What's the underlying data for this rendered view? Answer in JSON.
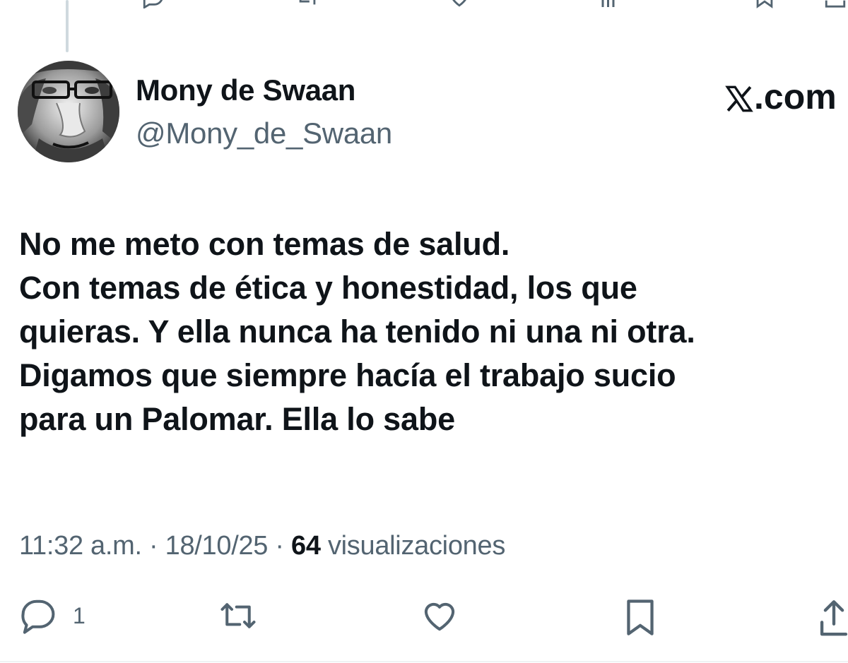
{
  "tweet": {
    "display_name": "Mony de Swaan",
    "handle": "@Mony_de_Swaan",
    "brand": ".com",
    "text_lines": [
      "No me meto con temas de salud.",
      "Con temas de ética y honestidad, los que",
      "quieras. Y ella nunca ha tenido ni una ni otra.",
      "Digamos que siempre hacía el trabajo sucio",
      "para un Palomar. Ella lo sabe"
    ],
    "time": "11:32 a.m.",
    "date": "18/10/25",
    "separator": " · ",
    "views_count": "64",
    "views_label": "visualizaciones",
    "reply_count": "1"
  },
  "icons": {
    "reply": "speech-bubble-icon",
    "retweet": "retweet-icon",
    "like": "heart-icon",
    "bookmark": "bookmark-icon",
    "share": "share-icon",
    "brand": "x-logo-icon"
  },
  "colors": {
    "text": "#0f1419",
    "secondary": "#536471",
    "thread_line": "#cfd9de"
  }
}
